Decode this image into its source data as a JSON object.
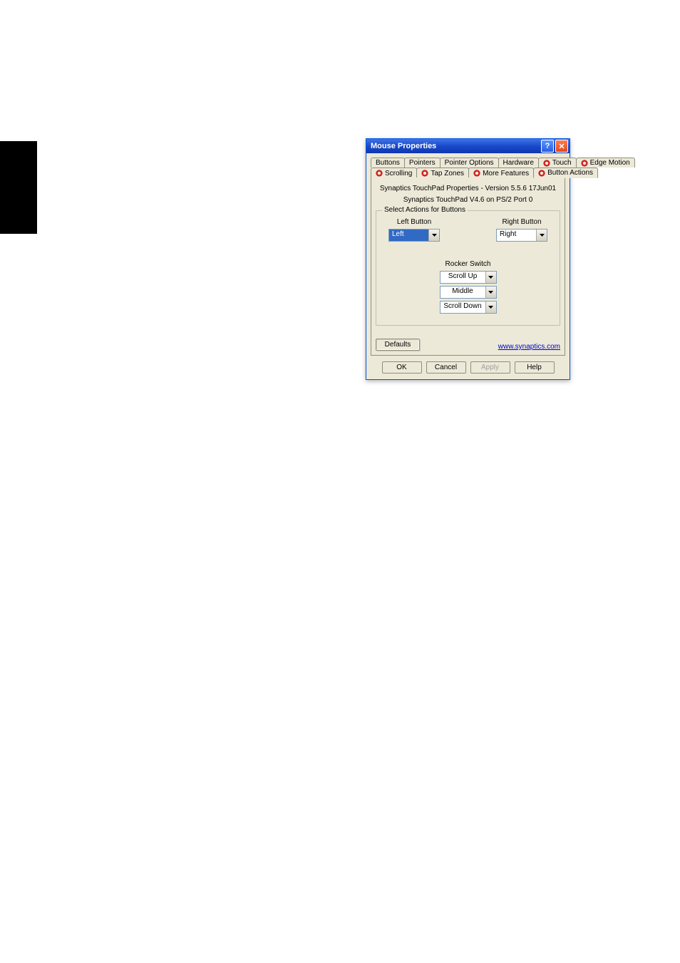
{
  "window": {
    "title": "Mouse Properties"
  },
  "tabs_row1": [
    {
      "label": "Buttons",
      "has_icon": false
    },
    {
      "label": "Pointers",
      "has_icon": false
    },
    {
      "label": "Pointer Options",
      "has_icon": false
    },
    {
      "label": "Hardware",
      "has_icon": false
    },
    {
      "label": "Touch",
      "has_icon": true
    },
    {
      "label": "Edge Motion",
      "has_icon": true
    }
  ],
  "tabs_row2": [
    {
      "label": "Scrolling",
      "has_icon": true
    },
    {
      "label": "Tap Zones",
      "has_icon": true
    },
    {
      "label": "More Features",
      "has_icon": true
    },
    {
      "label": "Button Actions",
      "has_icon": true
    }
  ],
  "content": {
    "line1": "Synaptics TouchPad Properties - Version 5.5.6 17Jun01",
    "line2": "Synaptics TouchPad V4.6 on PS/2 Port 0",
    "group_legend": "Select Actions for Buttons",
    "left_label": "Left Button",
    "right_label": "Right Button",
    "left_value": "Left",
    "right_value": "Right",
    "rocker_title": "Rocker Switch",
    "rocker_values": [
      "Scroll Up",
      "Middle",
      "Scroll Down"
    ],
    "defaults": "Defaults",
    "link": "www.synaptics.com"
  },
  "dialog_buttons": {
    "ok": "OK",
    "cancel": "Cancel",
    "apply": "Apply",
    "help": "Help"
  }
}
